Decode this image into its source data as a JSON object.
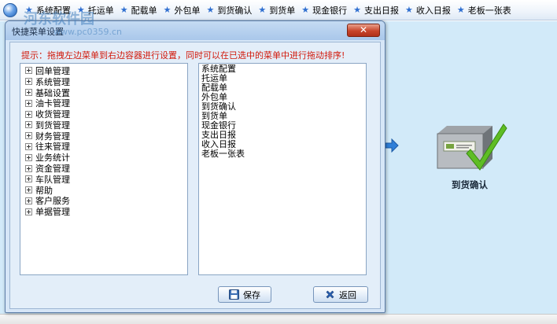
{
  "toolbar": {
    "items": [
      {
        "label": "系统配置"
      },
      {
        "label": "托运单"
      },
      {
        "label": "配载单"
      },
      {
        "label": "外包单"
      },
      {
        "label": "到货确认"
      },
      {
        "label": "到货单"
      },
      {
        "label": "现金银行"
      },
      {
        "label": "支出日报"
      },
      {
        "label": "收入日报"
      },
      {
        "label": "老板一张表"
      }
    ],
    "star_icon": "★"
  },
  "watermark": {
    "text": "河东软件园",
    "url": "www.pc0359.cn"
  },
  "dialog": {
    "title": "快捷菜单设置",
    "close_label": "✕",
    "hint": "提示：拖拽左边菜单到右边容器进行设置，同时可以在已选中的菜单中进行拖动排序!",
    "left_tree": [
      {
        "label": "回单管理"
      },
      {
        "label": "系统管理"
      },
      {
        "label": "基础设置"
      },
      {
        "label": "油卡管理"
      },
      {
        "label": "收货管理"
      },
      {
        "label": "到货管理"
      },
      {
        "label": "财务管理"
      },
      {
        "label": "往来管理"
      },
      {
        "label": "业务统计"
      },
      {
        "label": "资金管理"
      },
      {
        "label": "车队管理"
      },
      {
        "label": "帮助"
      },
      {
        "label": "客户服务"
      },
      {
        "label": "单据管理"
      }
    ],
    "right_list": [
      {
        "label": "系统配置"
      },
      {
        "label": "托运单"
      },
      {
        "label": "配载单"
      },
      {
        "label": "外包单"
      },
      {
        "label": "到货确认"
      },
      {
        "label": "到货单"
      },
      {
        "label": "现金银行"
      },
      {
        "label": "支出日报"
      },
      {
        "label": "收入日报"
      },
      {
        "label": "老板一张表"
      }
    ],
    "save_label": "保存",
    "back_label": "返回"
  },
  "workspace": {
    "icon_label": "到货确认",
    "background_color": "#d2eaf9"
  },
  "colors": {
    "hint_text": "#d2190b",
    "accent": "#2f6fd0"
  }
}
